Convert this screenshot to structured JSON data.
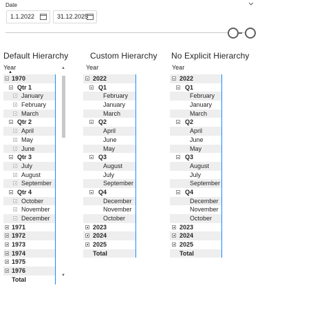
{
  "slicer": {
    "title": "Date",
    "start_date": "1.1.2022",
    "end_date": "31.12.2025",
    "icons": [
      "chevron-down-icon",
      "calendar-icon"
    ]
  },
  "visuals": [
    {
      "heading": "Default Hierarchy",
      "column_header": "Year",
      "rows": [
        {
          "label": "1970",
          "level": 0,
          "bold": true,
          "box": "minus"
        },
        {
          "label": "Qtr 1",
          "level": 1,
          "bold": true,
          "box": "minus"
        },
        {
          "label": "January",
          "level": 2,
          "bold": false,
          "box": "leaf"
        },
        {
          "label": "February",
          "level": 2,
          "bold": false,
          "box": "leaf"
        },
        {
          "label": "March",
          "level": 2,
          "bold": false,
          "box": "leaf"
        },
        {
          "label": "Qtr 2",
          "level": 1,
          "bold": true,
          "box": "minus"
        },
        {
          "label": "April",
          "level": 2,
          "bold": false,
          "box": "leaf"
        },
        {
          "label": "May",
          "level": 2,
          "bold": false,
          "box": "leaf"
        },
        {
          "label": "June",
          "level": 2,
          "bold": false,
          "box": "leaf"
        },
        {
          "label": "Qtr 3",
          "level": 1,
          "bold": true,
          "box": "minus"
        },
        {
          "label": "July",
          "level": 2,
          "bold": false,
          "box": "leaf"
        },
        {
          "label": "August",
          "level": 2,
          "bold": false,
          "box": "leaf"
        },
        {
          "label": "September",
          "level": 2,
          "bold": false,
          "box": "leaf"
        },
        {
          "label": "Qtr 4",
          "level": 1,
          "bold": true,
          "box": "minus"
        },
        {
          "label": "October",
          "level": 2,
          "bold": false,
          "box": "leaf"
        },
        {
          "label": "November",
          "level": 2,
          "bold": false,
          "box": "leaf"
        },
        {
          "label": "December",
          "level": 2,
          "bold": false,
          "box": "leaf"
        },
        {
          "label": "1971",
          "level": 0,
          "bold": true,
          "box": "plus"
        },
        {
          "label": "1972",
          "level": 0,
          "bold": true,
          "box": "plus"
        },
        {
          "label": "1973",
          "level": 0,
          "bold": true,
          "box": "plus"
        },
        {
          "label": "1974",
          "level": 0,
          "bold": true,
          "box": "plus"
        },
        {
          "label": "1975",
          "level": 0,
          "bold": true,
          "box": "plus"
        },
        {
          "label": "1976",
          "level": 0,
          "bold": true,
          "box": "plus"
        },
        {
          "label": "Total",
          "level": 0,
          "bold": true,
          "box": "none"
        }
      ]
    },
    {
      "heading": "Custom Hierarchy",
      "column_header": "Year",
      "rows": [
        {
          "label": "2022",
          "level": 0,
          "bold": true,
          "box": "minus"
        },
        {
          "label": "Q1",
          "level": 1,
          "bold": true,
          "box": "minus"
        },
        {
          "label": "February",
          "level": 2,
          "bold": false,
          "box": "none"
        },
        {
          "label": "January",
          "level": 2,
          "bold": false,
          "box": "none"
        },
        {
          "label": "March",
          "level": 2,
          "bold": false,
          "box": "none"
        },
        {
          "label": "Q2",
          "level": 1,
          "bold": true,
          "box": "minus"
        },
        {
          "label": "April",
          "level": 2,
          "bold": false,
          "box": "none"
        },
        {
          "label": "June",
          "level": 2,
          "bold": false,
          "box": "none"
        },
        {
          "label": "May",
          "level": 2,
          "bold": false,
          "box": "none"
        },
        {
          "label": "Q3",
          "level": 1,
          "bold": true,
          "box": "minus"
        },
        {
          "label": "August",
          "level": 2,
          "bold": false,
          "box": "none"
        },
        {
          "label": "July",
          "level": 2,
          "bold": false,
          "box": "none"
        },
        {
          "label": "September",
          "level": 2,
          "bold": false,
          "box": "none"
        },
        {
          "label": "Q4",
          "level": 1,
          "bold": true,
          "box": "minus"
        },
        {
          "label": "December",
          "level": 2,
          "bold": false,
          "box": "none"
        },
        {
          "label": "November",
          "level": 2,
          "bold": false,
          "box": "none"
        },
        {
          "label": "October",
          "level": 2,
          "bold": false,
          "box": "none"
        },
        {
          "label": "2023",
          "level": 0,
          "bold": true,
          "box": "plus"
        },
        {
          "label": "2024",
          "level": 0,
          "bold": true,
          "box": "plus"
        },
        {
          "label": "2025",
          "level": 0,
          "bold": true,
          "box": "plus"
        },
        {
          "label": "Total",
          "level": 0,
          "bold": true,
          "box": "none"
        }
      ]
    },
    {
      "heading": "No Explicit Hierarchy",
      "column_header": "Year",
      "rows": [
        {
          "label": "2022",
          "level": 0,
          "bold": true,
          "box": "minus"
        },
        {
          "label": "Q1",
          "level": 1,
          "bold": true,
          "box": "minus"
        },
        {
          "label": "February",
          "level": 2,
          "bold": false,
          "box": "none"
        },
        {
          "label": "January",
          "level": 2,
          "bold": false,
          "box": "none"
        },
        {
          "label": "March",
          "level": 2,
          "bold": false,
          "box": "none"
        },
        {
          "label": "Q2",
          "level": 1,
          "bold": true,
          "box": "minus"
        },
        {
          "label": "April",
          "level": 2,
          "bold": false,
          "box": "none"
        },
        {
          "label": "June",
          "level": 2,
          "bold": false,
          "box": "none"
        },
        {
          "label": "May",
          "level": 2,
          "bold": false,
          "box": "none"
        },
        {
          "label": "Q3",
          "level": 1,
          "bold": true,
          "box": "minus"
        },
        {
          "label": "August",
          "level": 2,
          "bold": false,
          "box": "none"
        },
        {
          "label": "July",
          "level": 2,
          "bold": false,
          "box": "none"
        },
        {
          "label": "September",
          "level": 2,
          "bold": false,
          "box": "none"
        },
        {
          "label": "Q4",
          "level": 1,
          "bold": true,
          "box": "minus"
        },
        {
          "label": "December",
          "level": 2,
          "bold": false,
          "box": "none"
        },
        {
          "label": "November",
          "level": 2,
          "bold": false,
          "box": "none"
        },
        {
          "label": "October",
          "level": 2,
          "bold": false,
          "box": "none"
        },
        {
          "label": "2023",
          "level": 0,
          "bold": true,
          "box": "plus"
        },
        {
          "label": "2024",
          "level": 0,
          "bold": true,
          "box": "plus"
        },
        {
          "label": "2025",
          "level": 0,
          "bold": true,
          "box": "plus"
        },
        {
          "label": "Total",
          "level": 0,
          "bold": true,
          "box": "none"
        }
      ]
    }
  ],
  "colors": {
    "accent_border": "#118dff",
    "alt_row": "#eeeeee",
    "text": "#252423"
  }
}
